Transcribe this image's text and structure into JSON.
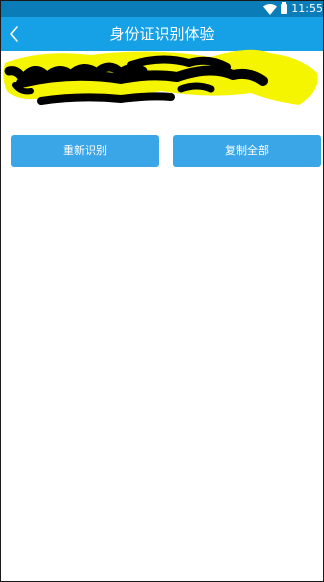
{
  "status_bar": {
    "time": "11:55",
    "wifi_icon": "wifi-icon",
    "battery_icon": "battery-icon",
    "background_color": "#0a7cb8"
  },
  "app_bar": {
    "title": "身份证识别体验",
    "back_icon": "chevron-left-icon",
    "background_color": "#16a1e7"
  },
  "result": {
    "redaction_colors": [
      "#f5f500",
      "#000000"
    ]
  },
  "actions": {
    "rescan_label": "重新识别",
    "copy_all_label": "复制全部",
    "button_color": "#3aa6e8"
  }
}
